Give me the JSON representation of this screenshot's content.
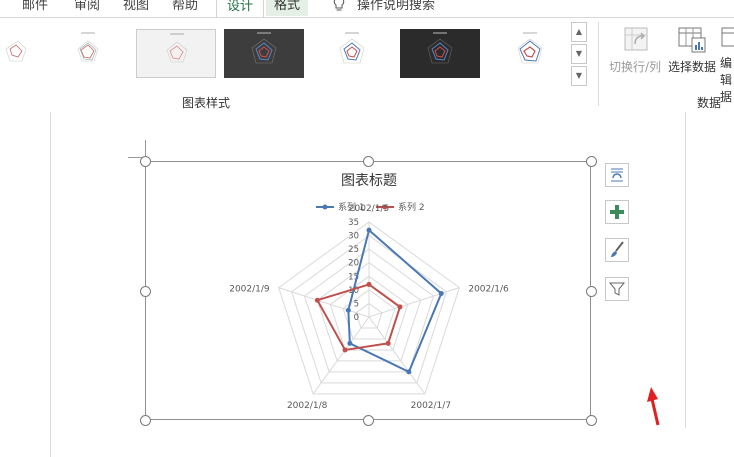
{
  "tabs": {
    "t1": "邮件",
    "t2": "审阅",
    "t3": "视图",
    "t4": "帮助",
    "design": "设计",
    "format": "格式",
    "search": "操作说明搜索"
  },
  "ribbon": {
    "styles_group_label": "图表样式",
    "data_group_label": "数据",
    "switch_row_col": "切换行/列",
    "select_data": "选择数据",
    "edit_data_partial": "编辑",
    "edit_data_partial2": "据"
  },
  "chart_data": {
    "type": "radar",
    "title": "图表标题",
    "categories": [
      "2002/1/5",
      "2002/1/6",
      "2002/1/7",
      "2002/1/8",
      "2002/1/9"
    ],
    "series": [
      {
        "name": "系列 1",
        "color": "#4a78b5",
        "values": [
          32,
          28,
          25,
          12,
          8
        ]
      },
      {
        "name": "系列 2",
        "color": "#c0504d",
        "values": [
          12,
          12,
          12,
          15,
          20
        ]
      }
    ],
    "r_ticks": [
      "0",
      "5",
      "10",
      "15",
      "20",
      "25",
      "30",
      "35"
    ],
    "r_max": 35,
    "legend_position": "top"
  }
}
